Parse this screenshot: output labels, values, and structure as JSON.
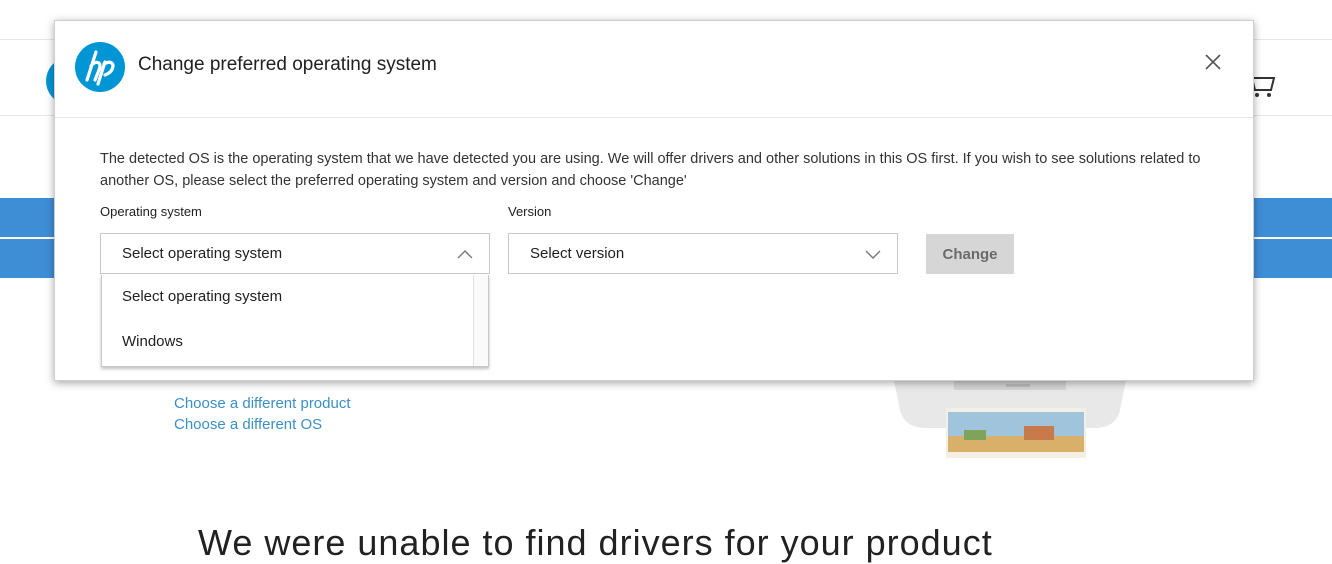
{
  "background": {
    "links": [
      "Choose a different product",
      "Choose a different OS"
    ],
    "headline": "We were unable to find drivers for your product"
  },
  "modal": {
    "title": "Change preferred operating system",
    "description": "The detected OS is the operating system that we have detected you are using. We will offer drivers and other solutions in this OS first. If you wish to see solutions related to another OS, please select the preferred operating system and version and choose 'Change'",
    "os_label": "Operating system",
    "os_selected": "Select operating system",
    "version_label": "Version",
    "version_selected": "Select version",
    "change_label": "Change",
    "os_options": [
      "Select operating system",
      "Windows"
    ]
  },
  "colors": {
    "brand": "#0096d6",
    "band": "#3e8ed6",
    "link": "#3b8fc6",
    "disabled_button": "#d6d6d6"
  },
  "icons": {
    "logo": "hp-logo-icon",
    "close": "close-icon",
    "chevron_up": "chevron-up-icon",
    "chevron_down": "chevron-down-icon",
    "cart": "cart-icon"
  }
}
